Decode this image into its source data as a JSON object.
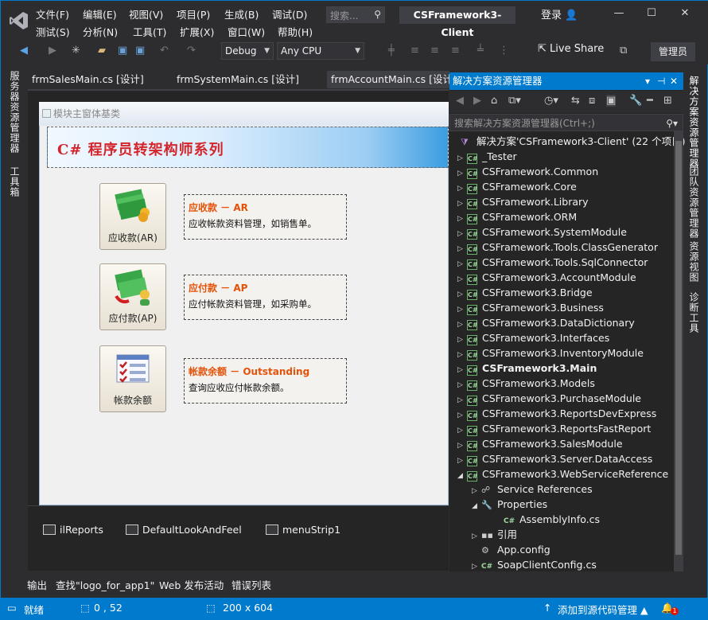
{
  "menu": {
    "row1": [
      "文件(F)",
      "编辑(E)",
      "视图(V)",
      "项目(P)",
      "生成(B)",
      "调试(D)"
    ],
    "row2": [
      "测试(S)",
      "分析(N)",
      "工具(T)",
      "扩展(X)",
      "窗口(W)",
      "帮助(H)"
    ]
  },
  "search": {
    "placeholder": "搜索..."
  },
  "window": {
    "title": "CSFramework3-Client",
    "login": "登录"
  },
  "toolbar": {
    "config": "Debug",
    "platform": "Any CPU",
    "live_share": "Live Share",
    "admin": "管理员"
  },
  "left_tabs": [
    "服务器资源管理器",
    "工具箱"
  ],
  "doc_tabs": [
    "frmSalesMain.cs [设计]",
    "frmSystemMain.cs [设计]",
    "frmAccountMain.cs [设计]"
  ],
  "designer": {
    "form_title": "模块主窗体基类",
    "banner": "C# 程序员转架构师系列",
    "buttons": [
      {
        "label": "应收款(AR)",
        "title": "应收款 － AR",
        "desc": "应收帐款资料管理，如销售单。"
      },
      {
        "label": "应付款(AP)",
        "title": "应付款 － AP",
        "desc": "应付帐款资料管理，如采购单。"
      },
      {
        "label": "帐款余额",
        "title": "帐款余额 － Outstanding",
        "desc": "查询应收应付帐款余额。"
      }
    ],
    "tray": [
      "ilReports",
      "DefaultLookAndFeel",
      "menuStrip1"
    ]
  },
  "bottom_tabs": [
    "输出",
    "查找\"logo_for_app1\"",
    "Web 发布活动",
    "错误列表"
  ],
  "solution_explorer": {
    "title": "解决方案资源管理器",
    "search_placeholder": "搜索解决方案资源管理器(Ctrl+;)",
    "solution": "解决方案'CSFramework3-Client' (22 个项目)",
    "projects": [
      "_Tester",
      "CSFramework.Common",
      "CSFramework.Core",
      "CSFramework.Library",
      "CSFramework.ORM",
      "CSFramework.SystemModule",
      "CSFramework.Tools.ClassGenerator",
      "CSFramework.Tools.SqlConnector",
      "CSFramework3.AccountModule",
      "CSFramework3.Bridge",
      "CSFramework3.Business",
      "CSFramework3.DataDictionary",
      "CSFramework3.Interfaces",
      "CSFramework3.InventoryModule",
      "CSFramework3.Main",
      "CSFramework3.Models",
      "CSFramework3.PurchaseModule",
      "CSFramework3.ReportsDevExpress",
      "CSFramework3.ReportsFastReport",
      "CSFramework3.SalesModule",
      "CSFramework3.Server.DataAccess",
      "CSFramework3.WebServiceReference"
    ],
    "children": {
      "service_references": "Service References",
      "properties": "Properties",
      "assembly_info": "AssemblyInfo.cs",
      "references": "引用",
      "app_config": "App.config",
      "soap_client_config": "SoapClientConfig.cs"
    }
  },
  "right_tabs": [
    "解决方案资源管理器",
    "团队资源管理器",
    "资源视图",
    "诊断工具"
  ],
  "status": {
    "ready": "就绪",
    "position": "0 , 52",
    "size": "200 x 604",
    "source_control": "添加到源代码管理 ▲",
    "notifications": "1"
  },
  "colors": {
    "accent": "#007acc",
    "banner_text": "#d4262a",
    "desc_title": "#e4520a"
  }
}
